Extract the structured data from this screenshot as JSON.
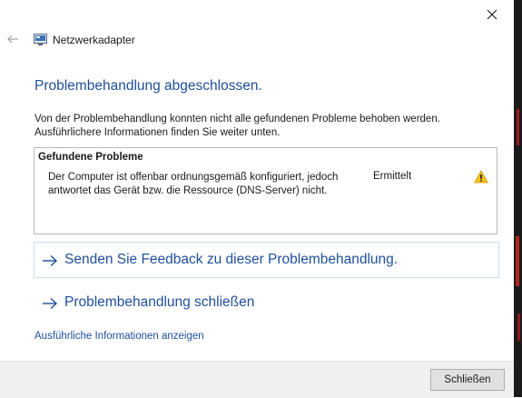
{
  "window": {
    "title": "Netzwerkadapter",
    "close_icon": "close-icon",
    "back_icon": "back-arrow-icon",
    "app_icon": "network-adapter-icon"
  },
  "main": {
    "heading": "Problembehandlung abgeschlossen.",
    "description_line1": "Von der Problembehandlung konnten nicht alle gefundenen Probleme behoben werden.",
    "description_line2": "Ausführlichere Informationen finden Sie weiter unten.",
    "problems": {
      "header": "Gefundene Probleme",
      "items": [
        {
          "line1": "Der Computer ist offenbar ordnungsgemäß konfiguriert, jedoch",
          "line2": "antwortet das Gerät bzw. die Ressource (DNS-Server) nicht.",
          "status": "Ermittelt",
          "icon": "warning-icon"
        }
      ]
    },
    "links": {
      "feedback": "Senden Sie Feedback zu dieser Problembehandlung.",
      "close_troubleshooter": "Problembehandlung schließen"
    },
    "details_link": "Ausführliche Informationen anzeigen"
  },
  "footer": {
    "close_button": "Schließen"
  },
  "colors": {
    "link_blue": "#1f4e9b",
    "warning_yellow": "#f4c01e",
    "footer_bg": "#f0f0f0"
  }
}
